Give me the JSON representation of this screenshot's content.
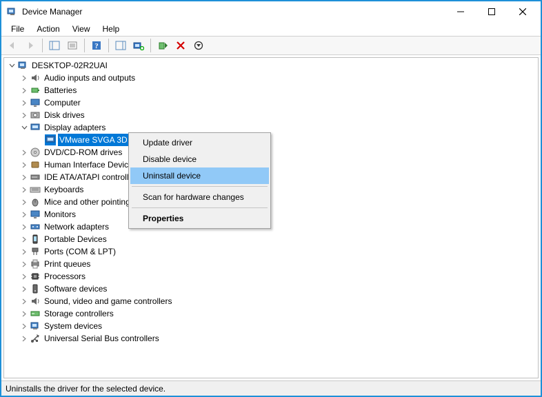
{
  "window": {
    "title": "Device Manager"
  },
  "menu": {
    "file": "File",
    "action": "Action",
    "view": "View",
    "help": "Help"
  },
  "tree": {
    "root": "DESKTOP-02R2UAI",
    "audio": "Audio inputs and outputs",
    "batteries": "Batteries",
    "computer": "Computer",
    "disks": "Disk drives",
    "display": "Display adapters",
    "display_child": "VMware SVGA 3D",
    "dvd": "DVD/CD-ROM drives",
    "hid": "Human Interface Devices",
    "ide": "IDE ATA/ATAPI controllers",
    "keyboards": "Keyboards",
    "mice": "Mice and other pointing devices",
    "monitors": "Monitors",
    "network": "Network adapters",
    "portable": "Portable Devices",
    "ports": "Ports (COM & LPT)",
    "print": "Print queues",
    "processors": "Processors",
    "software": "Software devices",
    "sound": "Sound, video and game controllers",
    "storage": "Storage controllers",
    "system": "System devices",
    "usb": "Universal Serial Bus controllers"
  },
  "context": {
    "update": "Update driver",
    "disable": "Disable device",
    "uninstall": "Uninstall device",
    "scan": "Scan for hardware changes",
    "properties": "Properties"
  },
  "status": {
    "text": "Uninstalls the driver for the selected device."
  }
}
